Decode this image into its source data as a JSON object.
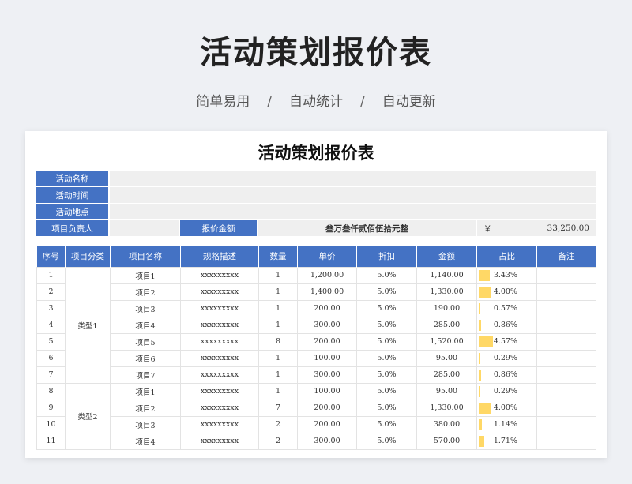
{
  "hero": {
    "title": "活动策划报价表",
    "subtitle_items": [
      "简单易用",
      "自动统计",
      "自动更新"
    ],
    "separator": "/"
  },
  "sheet": {
    "title": "活动策划报价表",
    "info": {
      "activity_name_label": "活动名称",
      "activity_time_label": "活动时间",
      "activity_place_label": "活动地点",
      "manager_label": "项目负责人",
      "quote_amount_label": "报价金额",
      "amount_in_words": "叁万叁仟贰佰伍拾元整",
      "currency_symbol": "￥",
      "amount_total": "33,250.00"
    },
    "columns": [
      "序号",
      "项目分类",
      "项目名称",
      "规格描述",
      "数量",
      "单价",
      "折扣",
      "金额",
      "占比",
      "备注"
    ],
    "groups": [
      {
        "type": "类型1",
        "rows": [
          {
            "no": "1",
            "name": "项目1",
            "spec": "xxxxxxxxx",
            "qty": "1",
            "price": "1,200.00",
            "discount": "5.0%",
            "amount": "1,140.00",
            "pct": "3.43%",
            "share": 3.43,
            "note": ""
          },
          {
            "no": "2",
            "name": "项目2",
            "spec": "xxxxxxxxx",
            "qty": "1",
            "price": "1,400.00",
            "discount": "5.0%",
            "amount": "1,330.00",
            "pct": "4.00%",
            "share": 4.0,
            "note": ""
          },
          {
            "no": "3",
            "name": "项目3",
            "spec": "xxxxxxxxx",
            "qty": "1",
            "price": "200.00",
            "discount": "5.0%",
            "amount": "190.00",
            "pct": "0.57%",
            "share": 0.57,
            "note": ""
          },
          {
            "no": "4",
            "name": "项目4",
            "spec": "xxxxxxxxx",
            "qty": "1",
            "price": "300.00",
            "discount": "5.0%",
            "amount": "285.00",
            "pct": "0.86%",
            "share": 0.86,
            "note": ""
          },
          {
            "no": "5",
            "name": "项目5",
            "spec": "xxxxxxxxx",
            "qty": "8",
            "price": "200.00",
            "discount": "5.0%",
            "amount": "1,520.00",
            "pct": "4.57%",
            "share": 4.57,
            "note": ""
          },
          {
            "no": "6",
            "name": "项目6",
            "spec": "xxxxxxxxx",
            "qty": "1",
            "price": "100.00",
            "discount": "5.0%",
            "amount": "95.00",
            "pct": "0.29%",
            "share": 0.29,
            "note": ""
          },
          {
            "no": "7",
            "name": "项目7",
            "spec": "xxxxxxxxx",
            "qty": "1",
            "price": "300.00",
            "discount": "5.0%",
            "amount": "285.00",
            "pct": "0.86%",
            "share": 0.86,
            "note": ""
          }
        ]
      },
      {
        "type": "类型2",
        "rows": [
          {
            "no": "8",
            "name": "项目1",
            "spec": "xxxxxxxxx",
            "qty": "1",
            "price": "100.00",
            "discount": "5.0%",
            "amount": "95.00",
            "pct": "0.29%",
            "share": 0.29,
            "note": ""
          },
          {
            "no": "9",
            "name": "项目2",
            "spec": "xxxxxxxxx",
            "qty": "7",
            "price": "200.00",
            "discount": "5.0%",
            "amount": "1,330.00",
            "pct": "4.00%",
            "share": 4.0,
            "note": ""
          },
          {
            "no": "10",
            "name": "项目3",
            "spec": "xxxxxxxxx",
            "qty": "2",
            "price": "200.00",
            "discount": "5.0%",
            "amount": "380.00",
            "pct": "1.14%",
            "share": 1.14,
            "note": ""
          },
          {
            "no": "11",
            "name": "项目4",
            "spec": "xxxxxxxxx",
            "qty": "2",
            "price": "300.00",
            "discount": "5.0%",
            "amount": "570.00",
            "pct": "1.71%",
            "share": 1.71,
            "note": ""
          }
        ]
      }
    ]
  },
  "colors": {
    "header_blue": "#4472c4",
    "bar_yellow": "#ffd866",
    "info_gray": "#efefef"
  }
}
